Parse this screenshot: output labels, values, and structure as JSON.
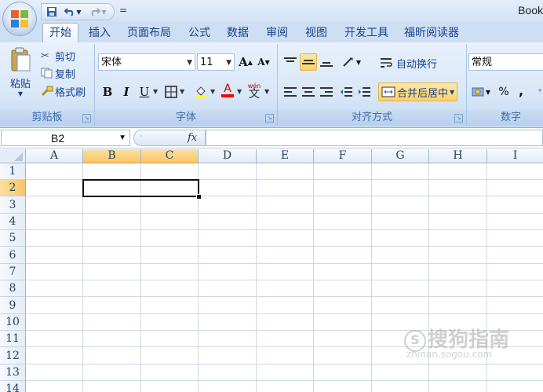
{
  "window": {
    "title": "Book"
  },
  "quick_access": {
    "save_icon": "save-icon",
    "undo_icon": "undo-icon",
    "redo_icon": "redo-icon",
    "customize_label": "="
  },
  "tabs": [
    {
      "label": "开始",
      "active": true
    },
    {
      "label": "插入"
    },
    {
      "label": "页面布局"
    },
    {
      "label": "公式"
    },
    {
      "label": "数据"
    },
    {
      "label": "审阅"
    },
    {
      "label": "视图"
    },
    {
      "label": "开发工具"
    },
    {
      "label": "福昕阅读器"
    }
  ],
  "ribbon": {
    "clipboard": {
      "paste": "粘贴",
      "cut": "剪切",
      "copy": "复制",
      "format_painter": "格式刷",
      "label": "剪贴板"
    },
    "font": {
      "name": "宋体",
      "size": "11",
      "bold": "B",
      "italic": "I",
      "underline": "U",
      "grow": "A",
      "shrink": "A",
      "font_color_letter": "A",
      "phonetic": "wén",
      "label": "字体"
    },
    "alignment": {
      "wrap_text": "自动换行",
      "merge_center": "合并后居中",
      "label": "对齐方式"
    },
    "number": {
      "format": "常规",
      "percent": "%",
      "comma": ",",
      "label": "数字"
    }
  },
  "formula_bar": {
    "name_box": "B2",
    "fx": "fx",
    "content": ""
  },
  "sheet": {
    "columns": [
      "A",
      "B",
      "C",
      "D",
      "E",
      "F",
      "G",
      "H",
      "I"
    ],
    "rows": [
      "1",
      "2",
      "3",
      "4",
      "5",
      "6",
      "7",
      "8",
      "9",
      "10",
      "11",
      "12",
      "13",
      "14"
    ],
    "selected_columns": [
      "B",
      "C"
    ],
    "selected_row": "2",
    "active_range": "B2:C2"
  },
  "watermark": {
    "text": "搜狗指南",
    "url": "zhinan.sogou.com",
    "mark": "S"
  },
  "colors": {
    "ribbon": "#d9e7f8",
    "selection_header": "#f7c565",
    "grid_line": "#d0d7e5",
    "text": "#15428b"
  }
}
